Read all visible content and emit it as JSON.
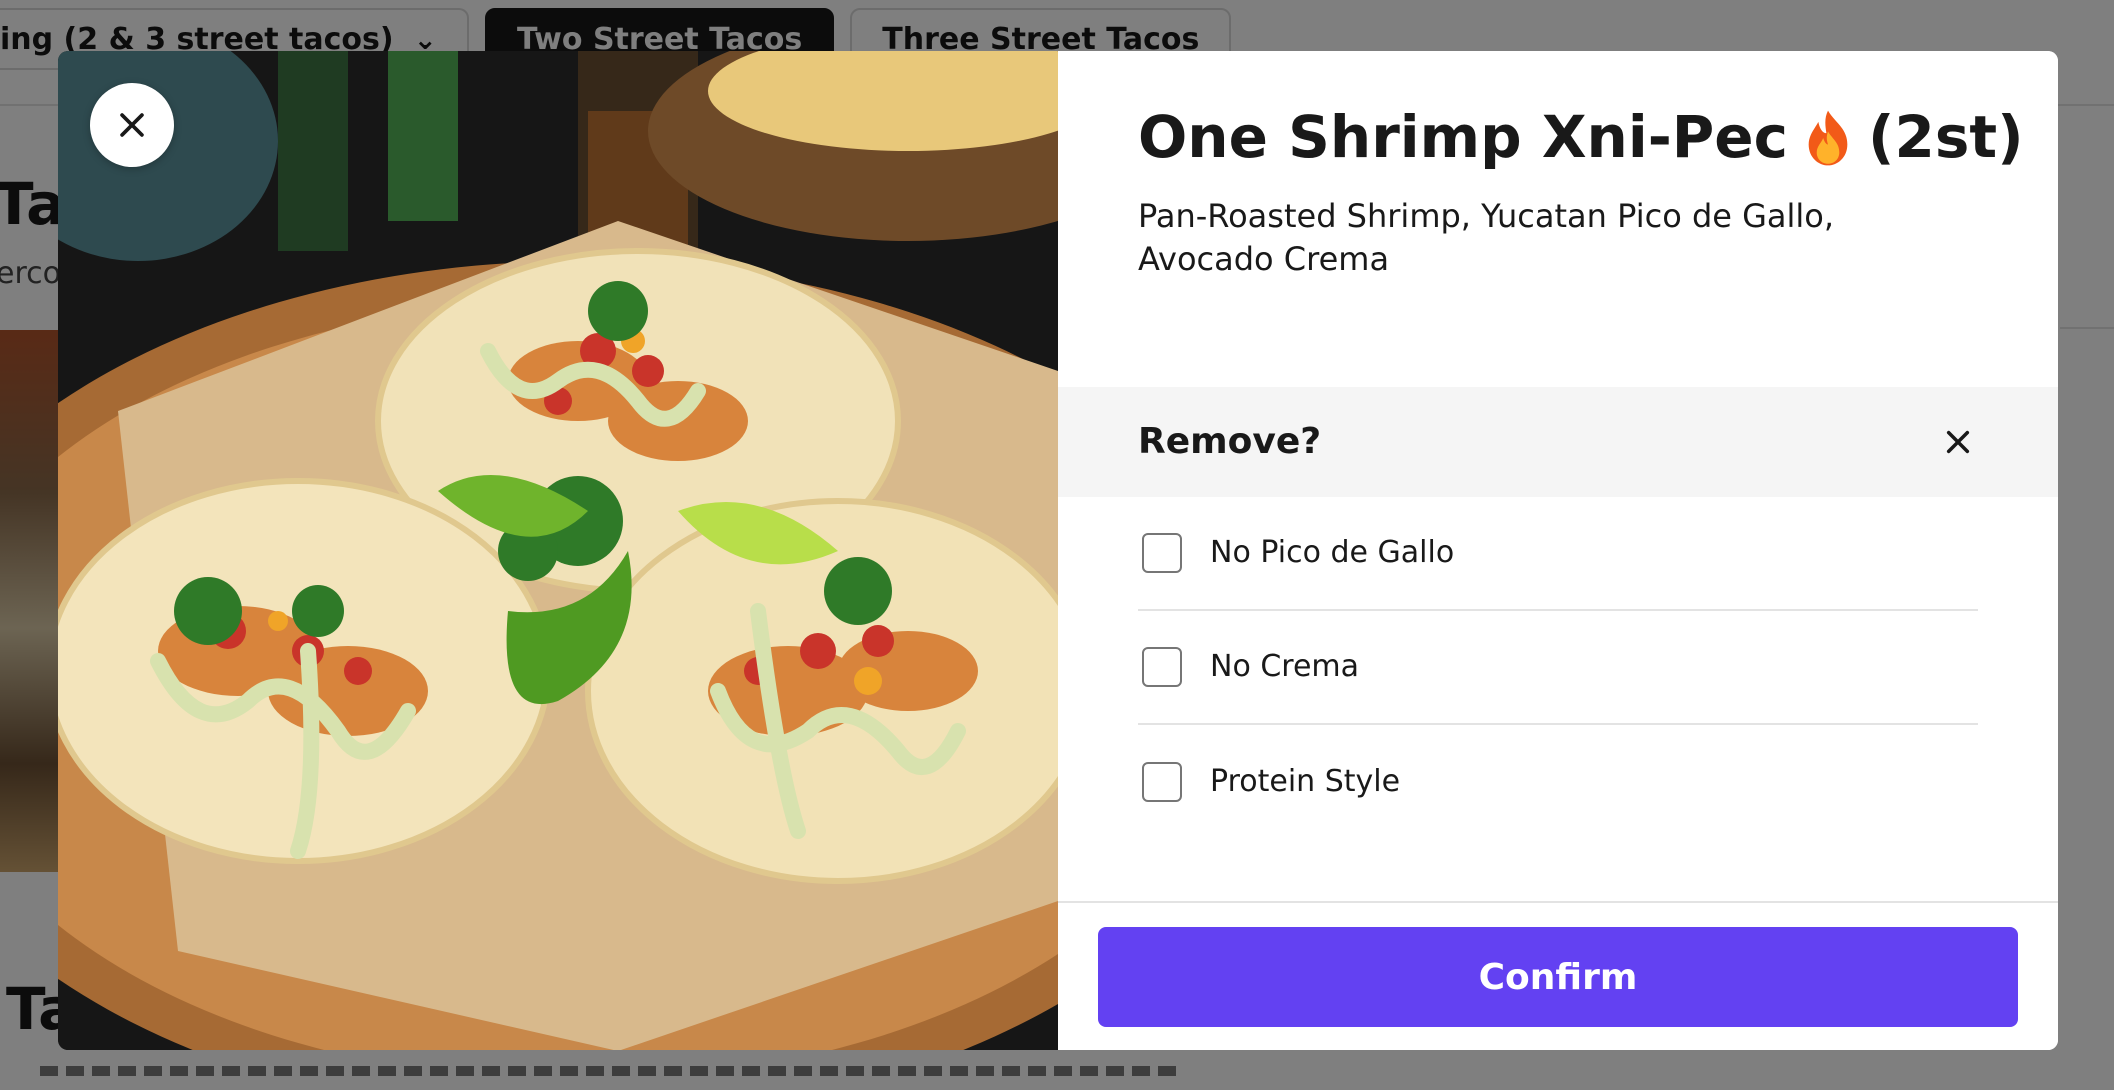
{
  "background": {
    "tabs": [
      {
        "label": "ing (2 & 3 street tacos)",
        "has_chevron": true
      },
      {
        "label": "Two Street Tacos",
        "active": true
      },
      {
        "label": "Three Street Tacos"
      }
    ],
    "section_heading": "Tac",
    "section_sub": "erco",
    "section_heading_2": "Ta"
  },
  "modal": {
    "image_alt": "Three shrimp street tacos topped with pico de gallo, cilantro and avocado crema on a wooden board with lime wedges",
    "item": {
      "title": "One Shrimp Xni-Pec",
      "title_icon": "fire-icon",
      "title_suffix": "(2st)",
      "description": "Pan-Roasted Shrimp, Yucatan Pico de Gallo, Avocado Crema"
    },
    "option_group": {
      "title": "Remove?",
      "options": [
        {
          "label": "No Pico de Gallo",
          "checked": false
        },
        {
          "label": "No Crema",
          "checked": false
        },
        {
          "label": "Protein Style",
          "checked": false
        }
      ]
    },
    "confirm_label": "Confirm"
  },
  "colors": {
    "accent": "#6341f2",
    "text": "#191919",
    "group_header_bg": "#f5f5f5",
    "overlay": "rgba(0,0,0,0.5)"
  }
}
